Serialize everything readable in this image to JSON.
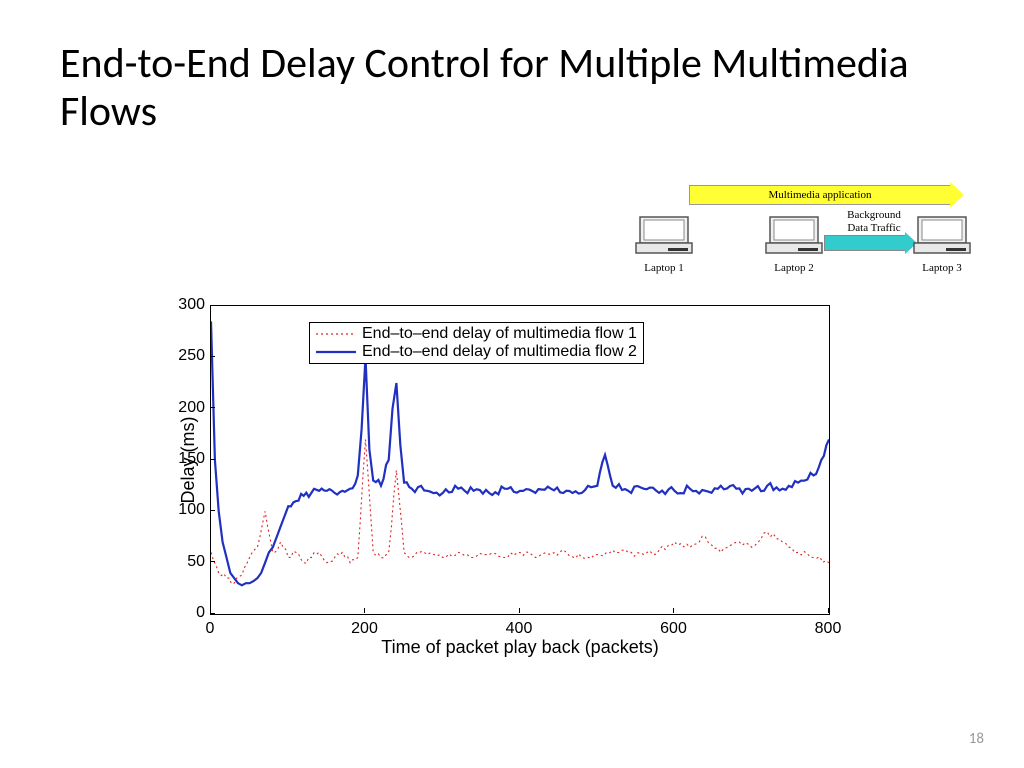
{
  "title": "End-to-End Delay Control for Multiple Multimedia Flows",
  "page_number": "18",
  "diagram": {
    "multimedia_arrow": "Multimedia application",
    "background_label_1": "Background",
    "background_label_2": "Data Traffic",
    "laptop1": "Laptop 1",
    "laptop2": "Laptop 2",
    "laptop3": "Laptop 3"
  },
  "chart_data": {
    "type": "line",
    "xlabel": "Time of packet play back (packets)",
    "ylabel": "Delay (ms)",
    "xlim": [
      0,
      800
    ],
    "ylim": [
      0,
      300
    ],
    "xticks": [
      0,
      200,
      400,
      600,
      800
    ],
    "yticks": [
      0,
      50,
      100,
      150,
      200,
      250,
      300
    ],
    "legend": {
      "position": "top-left",
      "entries": [
        "End–to–end delay of multimedia flow 1",
        "End–to–end delay of multimedia flow 2"
      ]
    },
    "series": [
      {
        "name": "End–to–end delay of multimedia flow 1",
        "style": "dotted",
        "color": "#e02020",
        "x": [
          0,
          10,
          20,
          30,
          40,
          50,
          60,
          70,
          80,
          90,
          100,
          110,
          120,
          130,
          140,
          150,
          160,
          170,
          180,
          190,
          200,
          210,
          220,
          230,
          240,
          250,
          260,
          270,
          280,
          300,
          320,
          340,
          360,
          380,
          400,
          420,
          440,
          460,
          480,
          500,
          520,
          540,
          560,
          580,
          600,
          620,
          640,
          660,
          680,
          700,
          720,
          740,
          760,
          780,
          800
        ],
        "values": [
          60,
          40,
          35,
          30,
          38,
          55,
          65,
          100,
          60,
          70,
          55,
          60,
          50,
          55,
          60,
          50,
          55,
          60,
          50,
          55,
          170,
          60,
          55,
          60,
          140,
          60,
          55,
          60,
          58,
          55,
          60,
          55,
          58,
          55,
          60,
          55,
          58,
          60,
          55,
          58,
          62,
          60,
          58,
          62,
          70,
          65,
          75,
          60,
          70,
          65,
          80,
          70,
          60,
          55,
          50
        ]
      },
      {
        "name": "End–to–end delay of multimedia flow 2",
        "style": "solid",
        "color": "#2030c0",
        "x": [
          0,
          5,
          10,
          15,
          20,
          25,
          30,
          35,
          40,
          45,
          50,
          55,
          60,
          65,
          70,
          75,
          80,
          85,
          90,
          95,
          100,
          110,
          120,
          130,
          140,
          150,
          160,
          170,
          180,
          190,
          195,
          200,
          205,
          210,
          220,
          230,
          235,
          240,
          245,
          250,
          260,
          280,
          300,
          320,
          340,
          360,
          380,
          400,
          420,
          440,
          460,
          480,
          500,
          510,
          520,
          540,
          560,
          580,
          600,
          620,
          640,
          660,
          680,
          700,
          720,
          740,
          760,
          780,
          790,
          800
        ],
        "values": [
          285,
          150,
          100,
          70,
          55,
          40,
          35,
          30,
          28,
          30,
          30,
          32,
          35,
          40,
          50,
          60,
          65,
          75,
          85,
          95,
          105,
          110,
          115,
          118,
          120,
          120,
          118,
          120,
          122,
          135,
          180,
          250,
          160,
          130,
          125,
          150,
          200,
          225,
          165,
          128,
          122,
          120,
          118,
          122,
          120,
          118,
          122,
          120,
          118,
          122,
          120,
          118,
          125,
          155,
          125,
          120,
          122,
          118,
          120,
          122,
          120,
          125,
          122,
          120,
          125,
          122,
          128,
          135,
          150,
          170
        ]
      }
    ]
  }
}
